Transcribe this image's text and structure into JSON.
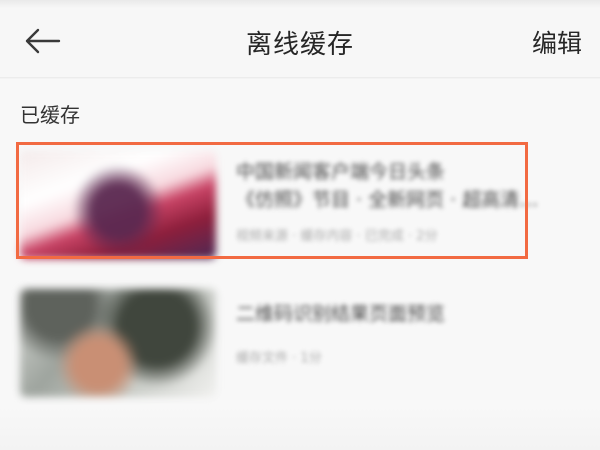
{
  "header": {
    "back_icon": "back-arrow-icon",
    "title": "离线缓存",
    "edit_label": "编辑"
  },
  "section": {
    "label": "已缓存"
  },
  "items": [
    {
      "title_line_1": "中国新闻客户端今日头条",
      "title_line_2": "《仿照》节目 · 全新网页 · 超高清影视...",
      "meta": "视频来源 · 缓存内容 · 已完成 · 2分"
    },
    {
      "title_line_1": "二维码识别结果页面预览",
      "meta": "缓存文件 · 1分"
    }
  ],
  "colors": {
    "highlight": "#f26a42",
    "background": "#f8f8f8"
  }
}
